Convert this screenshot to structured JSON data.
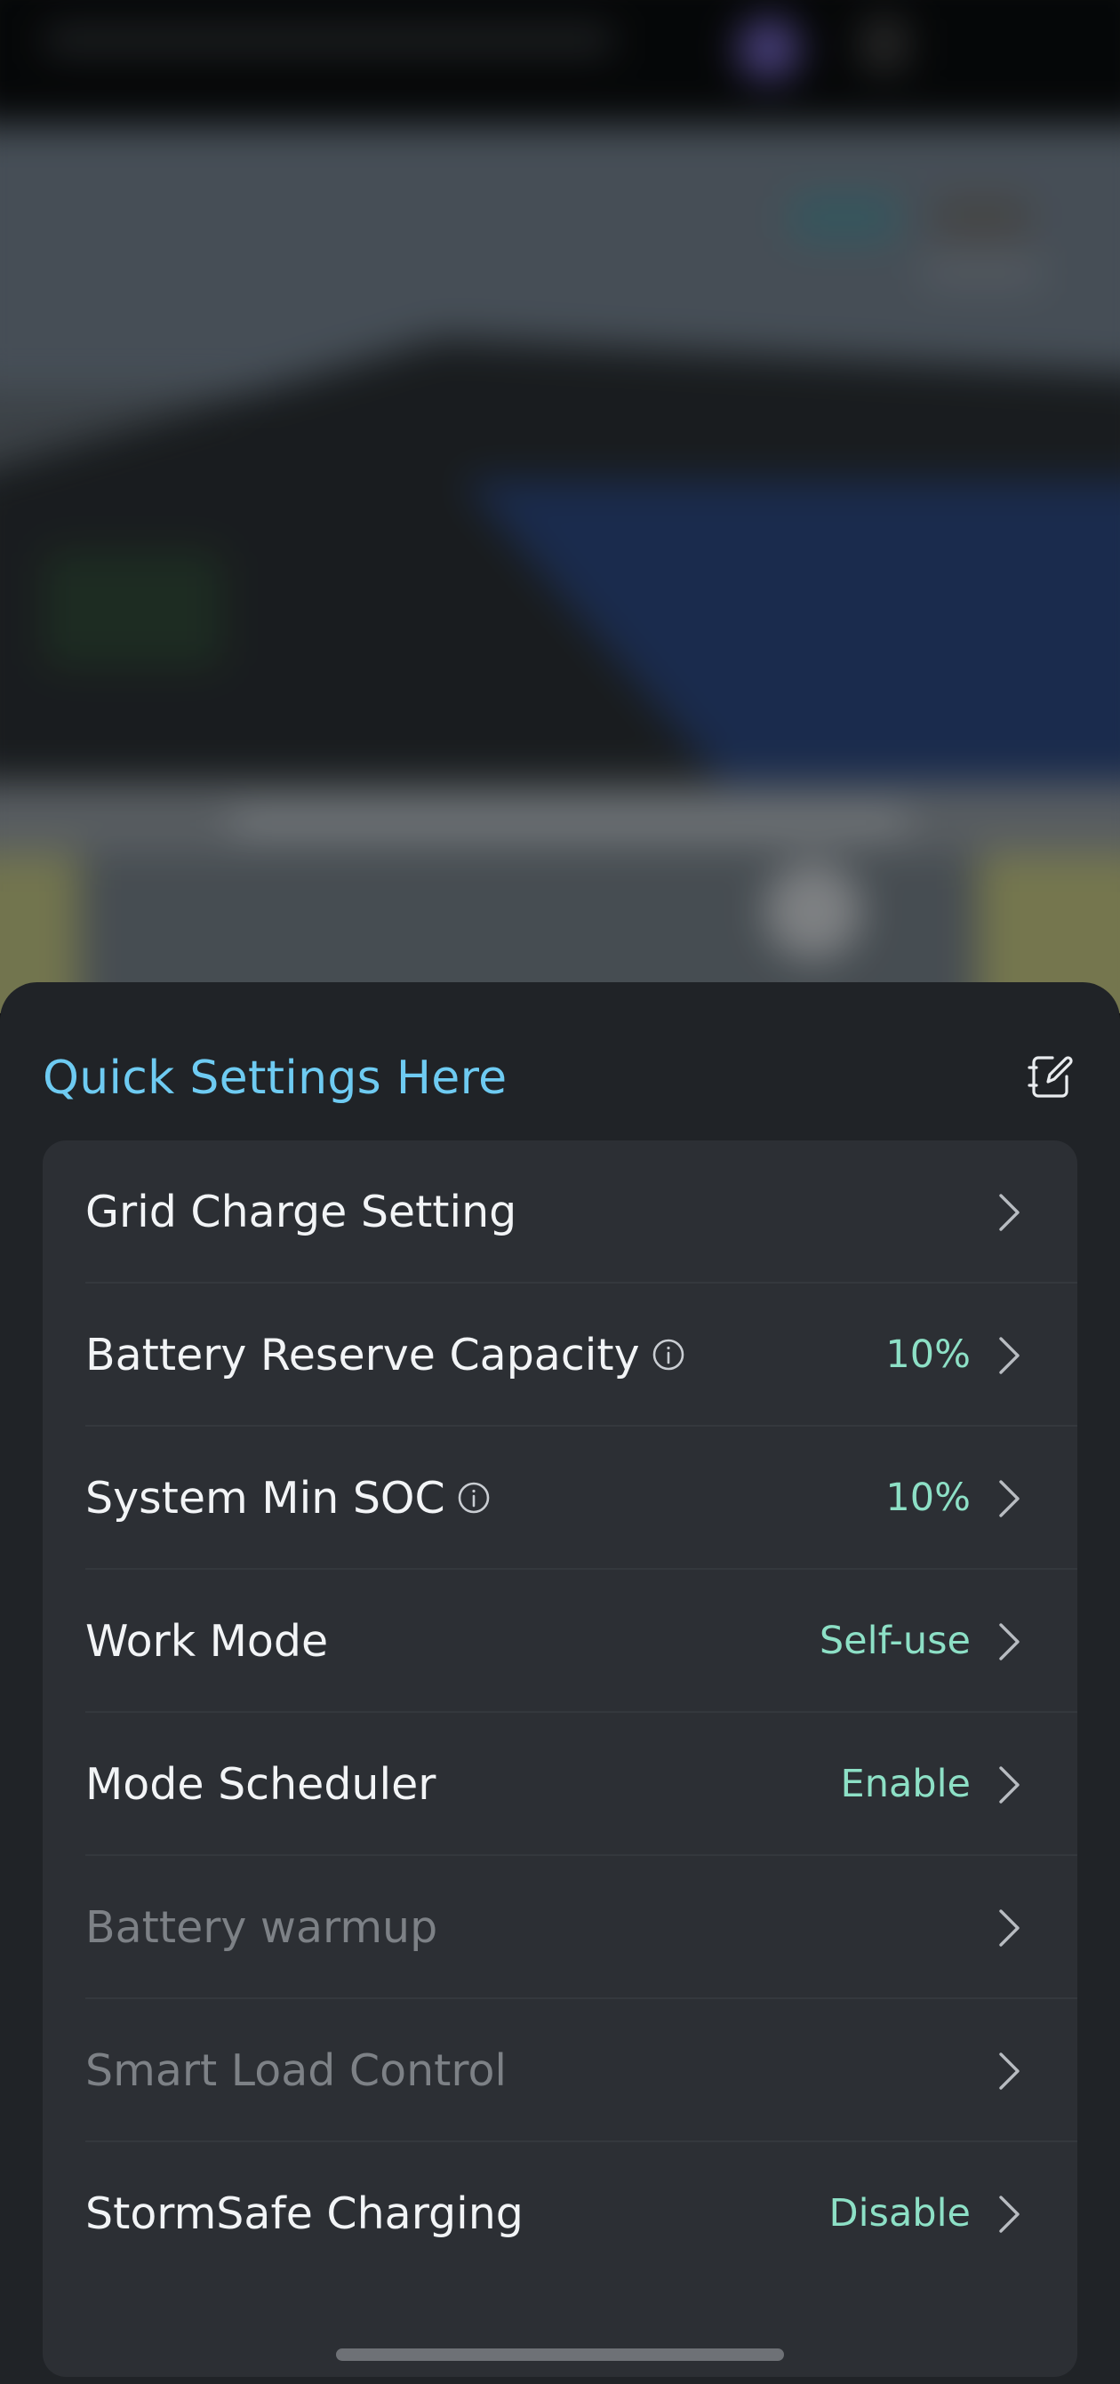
{
  "sheet": {
    "title": "Quick Settings Here",
    "edit_icon": "edit-icon"
  },
  "rows": [
    {
      "label": "Grid Charge Setting",
      "value": "",
      "has_info": false,
      "disabled": false
    },
    {
      "label": "Battery Reserve Capacity",
      "value": "10%",
      "has_info": true,
      "disabled": false
    },
    {
      "label": "System Min SOC",
      "value": "10%",
      "has_info": true,
      "disabled": false
    },
    {
      "label": "Work Mode",
      "value": "Self-use",
      "has_info": false,
      "disabled": false
    },
    {
      "label": "Mode Scheduler",
      "value": "Enable",
      "has_info": false,
      "disabled": false
    },
    {
      "label": "Battery warmup",
      "value": "",
      "has_info": false,
      "disabled": true
    },
    {
      "label": "Smart Load Control",
      "value": "",
      "has_info": false,
      "disabled": true
    },
    {
      "label": "StormSafe Charging",
      "value": "Disable",
      "has_info": false,
      "disabled": false
    }
  ],
  "colors": {
    "title_accent": "#6ecbf2",
    "value_accent": "#8de0c6",
    "sheet_bg": "#202327",
    "card_bg": "#2c2f34",
    "label_text": "#f2f4f6",
    "disabled_text": "#7d8186"
  },
  "icons": {
    "info": "info-circle-icon",
    "chevron": "chevron-right-icon"
  }
}
